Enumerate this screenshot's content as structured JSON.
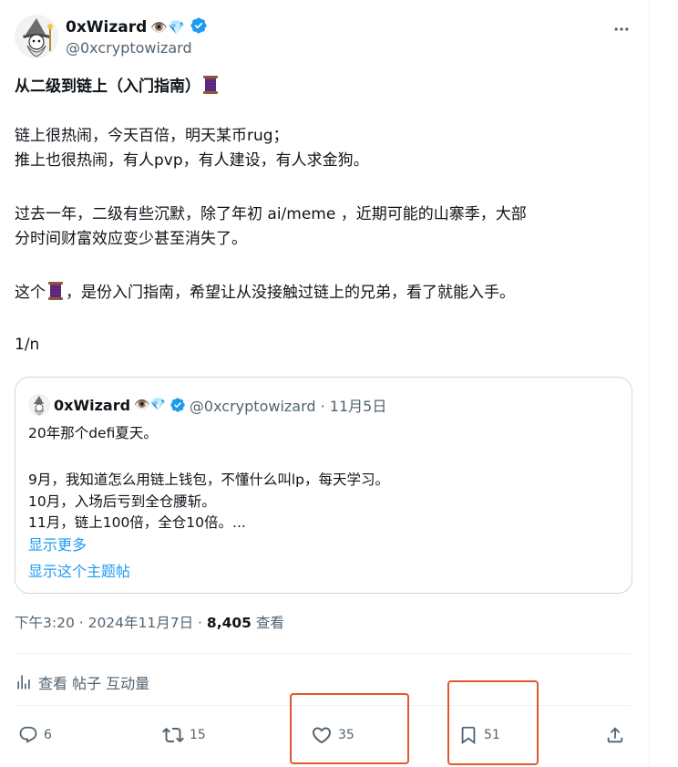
{
  "author": {
    "display_name": "0xWizard",
    "emoji": "👁️💎",
    "handle": "@0xcryptowizard"
  },
  "tweet": {
    "title": "从二级到链上（入门指南）",
    "para1_line1": "链上很热闹，今天百倍，明天某币rug；",
    "para1_line2": "推上也很热闹，有人pvp，有人建设，有人求金狗。",
    "para2_line1": "过去一年，二级有些沉默，除了年初 ai/meme ，近期可能的山寨季，大部",
    "para2_line2": "分时间财富效应变少甚至消失了。",
    "para3_prefix": "这个",
    "para3_suffix": "，是份入门指南，希望让从没接触过链上的兄弟，看了就能入手。",
    "counter": "1/n"
  },
  "quote": {
    "display_name": "0xWizard",
    "emoji": "👁️💎",
    "handle_date": "@0xcryptowizard · 11月5日",
    "line1": "20年那个defi夏天。",
    "line2": "9月，我知道怎么用链上钱包，不懂什么叫lp，每天学习。",
    "line3": "10月，入场后亏到全仓腰斩。",
    "line4": "11月，链上100倍，全仓10倍。...",
    "show_more": "显示更多",
    "show_thread": "显示这个主题帖"
  },
  "meta": {
    "time_date": "下午3:20 · 2024年11月7日 · ",
    "views_count": "8,405",
    "views_label": " 查看"
  },
  "analytics": {
    "label": "查看 帖子 互动量"
  },
  "actions": {
    "replies": "6",
    "reposts": "15",
    "likes": "35",
    "bookmarks": "51"
  },
  "colors": {
    "link": "#1d9bf0",
    "verified": "#1d9bf0",
    "highlight": "#e4572e",
    "secondary_text": "#536471"
  }
}
